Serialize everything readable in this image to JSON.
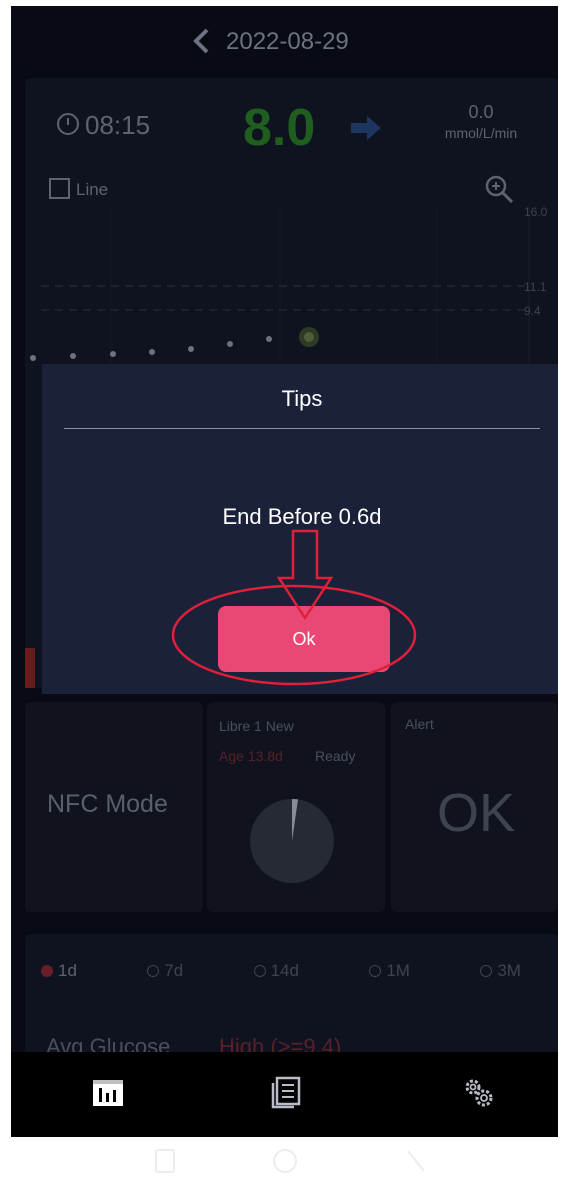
{
  "header": {
    "date": "2022-08-29"
  },
  "reading": {
    "time": "08:15",
    "glucose": "8.0",
    "rate": "0.0",
    "rate_unit": "mmol/L/min"
  },
  "chart": {
    "line_label": "Line",
    "y_labels": [
      "16.0",
      "11.1",
      "9.4"
    ]
  },
  "dialog": {
    "title": "Tips",
    "message": "End Before 0.6d",
    "ok_label": "Ok"
  },
  "tiles": {
    "mode": "NFC Mode",
    "sensor_name": "Libre 1 New",
    "sensor_age": "Age 13.8d",
    "sensor_status": "Ready",
    "alert_label": "Alert",
    "alert_status": "OK"
  },
  "ranges": {
    "options": [
      "1d",
      "7d",
      "14d",
      "1M",
      "3M"
    ],
    "selected": "1d"
  },
  "stats": {
    "avg_label": "Avg Glucose",
    "high_label": "High  (>=9.4)"
  },
  "nav": {
    "icons": [
      "chart-icon",
      "list-icon",
      "settings-icon"
    ]
  },
  "colors": {
    "ok_button": "#e84873",
    "dialog_bg": "#1a2139",
    "glucose": "#1f5e1e",
    "annotation": "#e0203a"
  }
}
